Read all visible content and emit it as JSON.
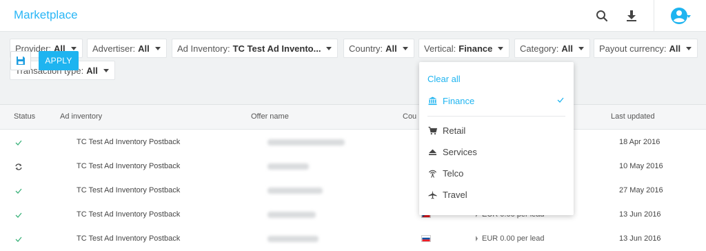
{
  "app": {
    "title": "Marketplace"
  },
  "header": {
    "icons": [
      "search-icon",
      "download-icon",
      "account-icon"
    ],
    "accent_color": "#29b6f6"
  },
  "filters": [
    {
      "label": "Provider:",
      "value": "All"
    },
    {
      "label": "Advertiser:",
      "value": "All"
    },
    {
      "label": "Ad Inventory:",
      "value": "TC Test Ad Invento..."
    },
    {
      "label": "Country:",
      "value": "All"
    },
    {
      "label": "Vertical:",
      "value": "Finance"
    },
    {
      "label": "Category:",
      "value": "All"
    },
    {
      "label": "Payout currency:",
      "value": "All"
    },
    {
      "label": "Transaction type:",
      "value": "All"
    }
  ],
  "actions": {
    "apply_label": "APPLY",
    "save_icon": "save-icon"
  },
  "table": {
    "columns": [
      "Status",
      "Ad inventory",
      "Offer name",
      "Cou",
      "Last updated"
    ],
    "rows": [
      {
        "status": "check",
        "ad_inventory": "TC Test Ad Inventory Postback",
        "country_flag": "",
        "payout": "",
        "last_updated": "18 Apr 2016"
      },
      {
        "status": "sync",
        "ad_inventory": "TC Test Ad Inventory Postback",
        "country_flag": "",
        "payout": "",
        "last_updated": "10 May 2016"
      },
      {
        "status": "check",
        "ad_inventory": "TC Test Ad Inventory Postback",
        "country_flag": "",
        "payout": "",
        "last_updated": "27 May 2016"
      },
      {
        "status": "check",
        "ad_inventory": "TC Test Ad Inventory Postback",
        "country_flag": "cz",
        "payout": "EUR 0.00 per lead",
        "last_updated": "13 Jun 2016"
      },
      {
        "status": "check",
        "ad_inventory": "TC Test Ad Inventory Postback",
        "country_flag": "sk",
        "payout": "EUR 0.00 per lead",
        "last_updated": "13 Jun 2016"
      }
    ]
  },
  "vertical_dropdown": {
    "clear_label": "Clear all",
    "selected": {
      "label": "Finance",
      "icon": "bank-icon"
    },
    "options": [
      {
        "label": "Retail",
        "icon": "cart-icon"
      },
      {
        "label": "Services",
        "icon": "eject-icon"
      },
      {
        "label": "Telco",
        "icon": "antenna-icon"
      },
      {
        "label": "Travel",
        "icon": "plane-icon"
      }
    ]
  }
}
